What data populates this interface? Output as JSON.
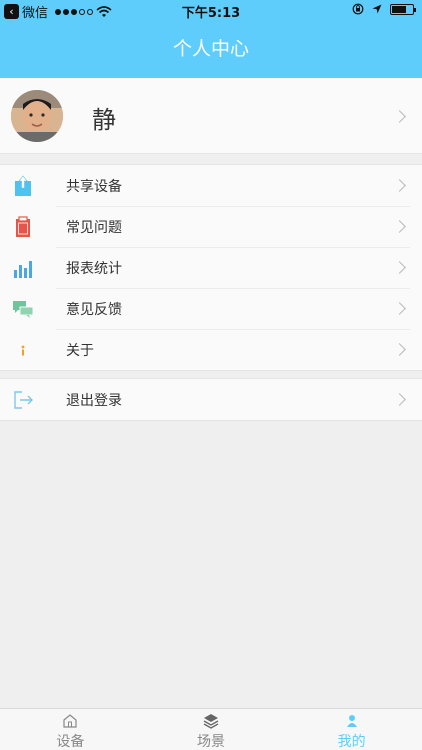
{
  "status_bar": {
    "back_app": "微信",
    "time": "下午5:13",
    "signal_filled": 3,
    "signal_total": 5,
    "battery_level": 0.7
  },
  "navbar": {
    "title": "个人中心"
  },
  "profile": {
    "name": "静"
  },
  "menu": {
    "share_device": "共享设备",
    "faq": "常见问题",
    "report_stats": "报表统计",
    "feedback": "意见反馈",
    "about": "关于",
    "logout": "退出登录"
  },
  "tabs": {
    "devices": "设备",
    "scenes": "场景",
    "mine": "我的"
  },
  "colors": {
    "accent": "#5fcdfb",
    "share_icon": "#4ec3f0",
    "faq_icon": "#e8534a",
    "report_icon": "#4aa7e6",
    "feedback_icon": "#6fc49b",
    "about_icon": "#f0a02a",
    "logout_icon": "#7cc8ea"
  },
  "icons": {
    "back": "back-arrow-icon",
    "wifi": "wifi-icon",
    "rotation_lock": "rotation-lock-icon",
    "location": "location-arrow-icon",
    "battery": "battery-icon",
    "share": "share-upload-icon",
    "faq": "clipboard-icon",
    "report": "bar-chart-icon",
    "feedback": "chat-bubbles-icon",
    "about": "info-icon",
    "logout": "logout-icon",
    "home": "home-icon",
    "layers": "layers-icon",
    "user": "user-icon"
  }
}
